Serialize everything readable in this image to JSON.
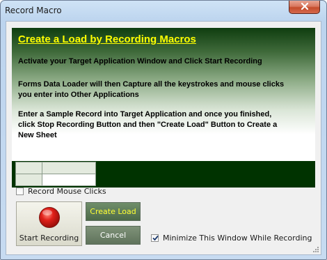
{
  "window": {
    "title": "Record Macro",
    "close_icon": "close-x-icon"
  },
  "banner": {
    "title": "Create a Load by Recording Macros",
    "paragraph1": [
      "Activate your Target Application Window and Click Start Recording"
    ],
    "paragraph2": [
      "Forms Data Loader will then Capture all the keystrokes and mouse clicks",
      "you enter into Other Applications"
    ],
    "paragraph3": [
      "Enter a Sample Record into Target Application and once you finished,",
      "click Stop Recording Button and then \"Create Load\" Button to Create a",
      "New Sheet"
    ]
  },
  "options": {
    "record_mouse_clicks_label": "Record Mouse Clicks",
    "record_mouse_clicks_checked": false,
    "minimize_window_label": "Minimize This Window While Recording",
    "minimize_window_checked": true
  },
  "buttons": {
    "start_recording": "Start Recording",
    "create_load": "Create Load",
    "cancel": "Cancel"
  },
  "colors": {
    "banner_title": "#ffff00",
    "banner_dark_green": "#0f3d0f",
    "grid_background": "#003300",
    "create_load_text": "#ffff33",
    "record_button_red": "#e0201a"
  }
}
